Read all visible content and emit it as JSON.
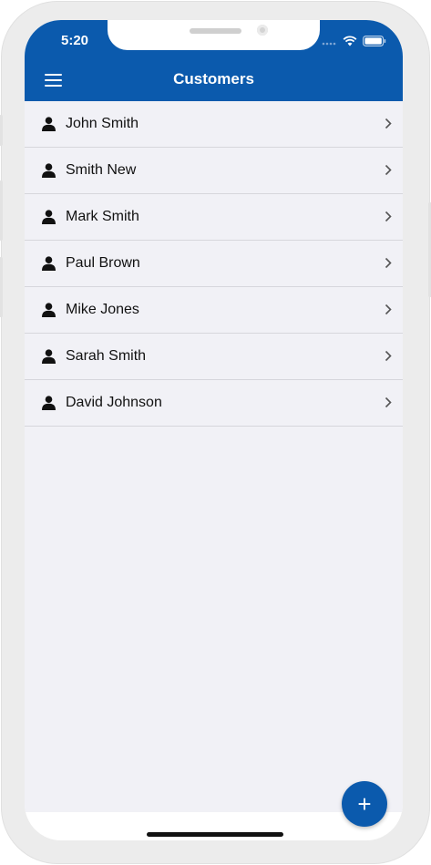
{
  "status_bar": {
    "time": "5:20",
    "signal_icon": "cellular-signal-icon",
    "wifi_icon": "wifi-icon",
    "battery_icon": "battery-icon"
  },
  "header": {
    "title": "Customers",
    "menu_icon": "hamburger-menu-icon"
  },
  "customers": [
    {
      "name": "John Smith"
    },
    {
      "name": "Smith New"
    },
    {
      "name": "Mark Smith"
    },
    {
      "name": "Paul Brown"
    },
    {
      "name": "Mike Jones"
    },
    {
      "name": "Sarah Smith"
    },
    {
      "name": "David Johnson"
    }
  ],
  "fab": {
    "label": "+"
  },
  "colors": {
    "primary": "#0b5aad",
    "list_background": "#f1f1f6",
    "divider": "#d6d6dc"
  }
}
